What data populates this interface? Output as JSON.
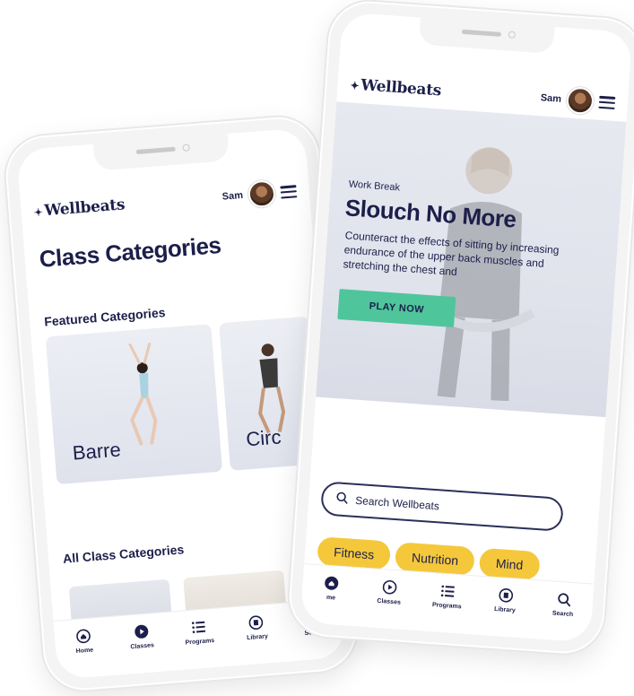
{
  "brand": {
    "logo_text": "Wellbeats",
    "logo_mark": "✦"
  },
  "user": {
    "name": "Sam"
  },
  "left_screen": {
    "page_title": "Class Categories",
    "featured_title": "Featured Categories",
    "featured_cards": [
      {
        "label": "Barre"
      },
      {
        "label": "Circ"
      }
    ],
    "all_title": "All Class Categories"
  },
  "right_screen": {
    "hero": {
      "eyebrow": "Work Break",
      "title": "Slouch No More",
      "description": "Counteract the effects of sitting by increasing endurance of the upper back muscles and stretching the chest and",
      "cta_label": "PLAY NOW"
    },
    "search": {
      "placeholder": "Search Wellbeats"
    },
    "chips": [
      "Fitness",
      "Nutrition",
      "Mind"
    ]
  },
  "bottom_nav": {
    "items": [
      {
        "label": "Home",
        "icon": "home-icon"
      },
      {
        "label": "Classes",
        "icon": "play-circle-icon"
      },
      {
        "label": "Programs",
        "icon": "list-icon"
      },
      {
        "label": "Library",
        "icon": "library-icon"
      },
      {
        "label": "Search",
        "icon": "search-icon"
      }
    ],
    "right_first_label": "me"
  },
  "colors": {
    "navy": "#1c1f4a",
    "mint": "#4fc59c",
    "yellow": "#f5c83b",
    "hero_bg": "#e4e6ee"
  }
}
